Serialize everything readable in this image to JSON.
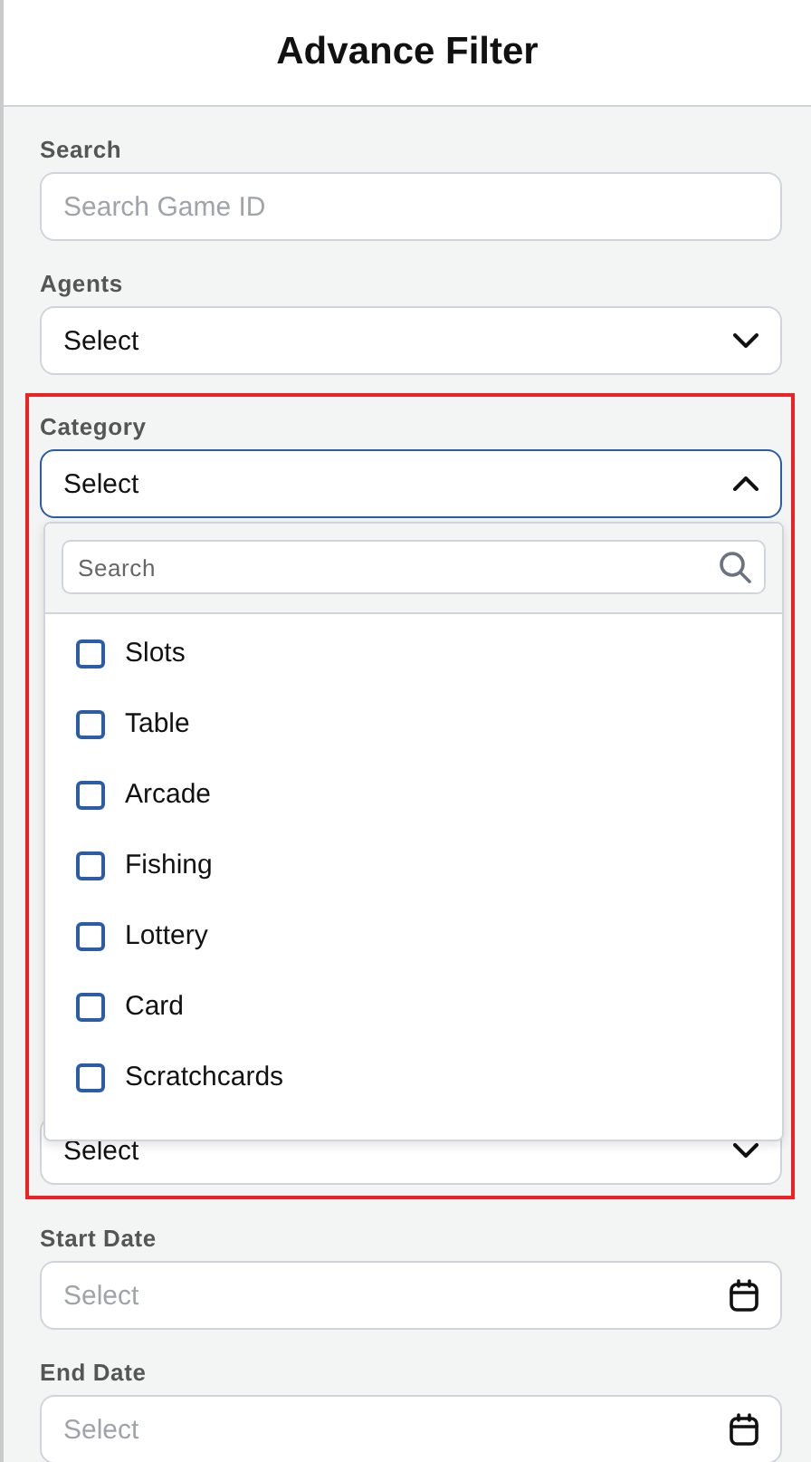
{
  "header": {
    "title": "Advance Filter"
  },
  "fields_top": [
    {
      "kind": "text",
      "label": "Search",
      "placeholder": "Search Game ID"
    },
    {
      "kind": "select",
      "label": "Agents",
      "value": "Select",
      "expanded": false
    }
  ],
  "highlight": {
    "field": {
      "kind": "select",
      "label": "Category",
      "value": "Select",
      "expanded": true
    },
    "dropdown": {
      "search": {
        "placeholder": "Search"
      },
      "options": [
        {
          "label": "Slots",
          "checked": false
        },
        {
          "label": "Table",
          "checked": false
        },
        {
          "label": "Arcade",
          "checked": false
        },
        {
          "label": "Fishing",
          "checked": false
        },
        {
          "label": "Lottery",
          "checked": false
        },
        {
          "label": "Card",
          "checked": false
        },
        {
          "label": "Scratchcards",
          "checked": false
        }
      ]
    },
    "covered_select": {
      "value": "Select",
      "expanded": false
    }
  },
  "fields_bottom": [
    {
      "kind": "date",
      "label": "Start Date",
      "placeholder": "Select"
    },
    {
      "kind": "date",
      "label": "End Date",
      "placeholder": "Select"
    }
  ]
}
